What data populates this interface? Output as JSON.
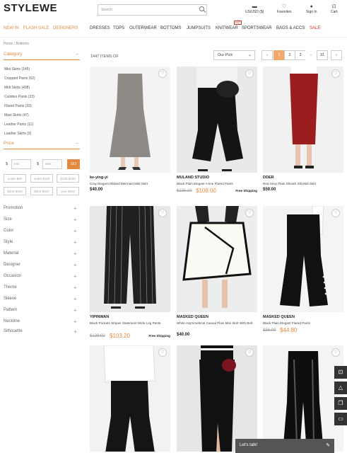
{
  "header": {
    "logo": "STYLEWE",
    "search_placeholder": "Search",
    "currency": "US/USD ($)",
    "favorites": "Favorites",
    "sign_in": "Sign In",
    "cart": "Cart"
  },
  "nav": {
    "new_in": "NEW IN",
    "flash_sale": "FLASH SALE",
    "designers": "DESIGNERS",
    "dresses": "DRESSES",
    "tops": "TOPS",
    "outerwear": "OUTERWEAR",
    "bottoms": "BOTTOMS",
    "jumpsuits": "JUMPSUITS",
    "knitwear": "KNITWEAR",
    "knitwear_tag": "HOT",
    "sportswear": "SPORTSWEAR",
    "bags": "BAGS & ACCS",
    "sale": "SALE"
  },
  "breadcrumb": "Home / Bottoms",
  "sidebar": {
    "category_title": "Category",
    "categories": [
      "Mini Skirts (145)",
      "Cropped Pants (62)",
      "Midi Skirts (438)",
      "Culottes Pants (23)",
      "Flared Pants (33)",
      "Maxi Skirts (47)",
      "Leather Pants (11)",
      "Leather Skirts (9)"
    ],
    "price_title": "Price",
    "min_placeholder": "Min",
    "max_placeholder": "Max",
    "currency_symbol": "$",
    "go": "GO",
    "ranges": [
      "under $90",
      "under $100",
      "$100-$200",
      "$200-$300",
      "$300-$400",
      "over $500"
    ],
    "filters": [
      "Promotion",
      "Size",
      "Color",
      "Style",
      "Material",
      "Designer",
      "Occasion",
      "Theme",
      "Sleeve",
      "Pattern",
      "Neckline",
      "Silhouette"
    ]
  },
  "toolbar": {
    "count": "1447 ITEMS OF",
    "sort": "Our Pick",
    "prev": "‹",
    "pages": [
      "1",
      "2",
      "3",
      "..",
      "31"
    ],
    "next": "›"
  },
  "products": [
    {
      "brand": "ke-ying-yi",
      "name": "Gray Elegant Ribbed Mermaid Midi Skirt",
      "price": "$40.00",
      "old": "",
      "sale": "",
      "ship": ""
    },
    {
      "brand": "MULAND STUDIO",
      "name": "Black Plain Elegant A-line Flared Pants",
      "price": "",
      "old": "$135.00",
      "sale": "$108.00",
      "ship": "Free Shipping"
    },
    {
      "brand": "DDER",
      "name": "Red Sexy Plain Sheath Slit Midi Skirt",
      "price": "$59.00",
      "old": "",
      "sale": "",
      "ship": ""
    },
    {
      "brand": "YIPINWAN",
      "name": "Black Pockets Stripes Statement Wide Leg Pants",
      "price": "",
      "old": "$129.00",
      "sale": "$103.20",
      "ship": "Free Shipping"
    },
    {
      "brand": "MASKED QUEEN",
      "name": "White Asymmetrical Casual Plain Mini Skirt With Belt",
      "price": "$40.00",
      "old": "",
      "sale": "",
      "ship": ""
    },
    {
      "brand": "MASKED QUEEN",
      "name": "Black Plain Elegant Flared Pants",
      "price": "",
      "old": "$56.00",
      "sale": "$44.80",
      "ship": ""
    }
  ],
  "chat": "Let's talk!"
}
